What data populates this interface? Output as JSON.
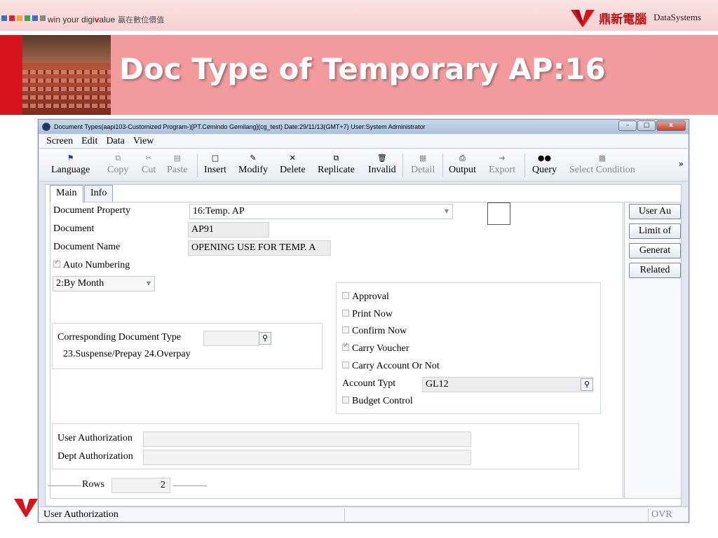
{
  "slide": {
    "tagline_prefix": "win your digi",
    "tagline_v": "v",
    "tagline_suffix": "alue",
    "tagline_zh": "贏在數位價值",
    "brand_zh": "鼎新電腦",
    "brand_en": "DataSystems",
    "title": "Doc Type of Temporary AP:16",
    "square_colors": [
      "#3a6fc4",
      "#d8262a",
      "#f2a93b",
      "#3aa64a",
      "#3a6fc4",
      "#888888"
    ]
  },
  "window": {
    "title": "Document Types(aapi103-Customized Program-)[PT.Cemindo Gemilang](cg_test)  Date:29/11/13(GMT+7)  User:System Administrator",
    "controls": {
      "minimize": "–",
      "maximize": "□",
      "close": "x"
    }
  },
  "menu": [
    "Screen",
    "Edit",
    "Data",
    "View"
  ],
  "toolbar": {
    "language": "Language",
    "copy": "Copy",
    "cut": "Cut",
    "paste": "Paste",
    "insert": "Insert",
    "modify": "Modify",
    "delete": "Delete",
    "replicate": "Replicate",
    "invalid": "Invalid",
    "detail": "Detail",
    "output": "Output",
    "export": "Export",
    "query": "Query",
    "select_condition": "Select Condition",
    "more": "»"
  },
  "tabs": {
    "main": "Main",
    "info": "Info"
  },
  "form": {
    "document_property_label": "Document Property",
    "document_property_value": "16:Temp. AP",
    "document_label": "Document",
    "document_value": "AP91",
    "document_name_label": "Document Name",
    "document_name_value": "OPENING USE FOR TEMP. A",
    "auto_numbering_label": "Auto Numbering",
    "auto_numbering_checked": true,
    "numbering_mode": "2:By Month",
    "corresponding_label": "Corresponding Document Type",
    "corresponding_value": "",
    "corresponding_hint": "23.Suspense/Prepay 24.Overpay",
    "approval_label": "Approval",
    "print_now_label": "Print Now",
    "confirm_now_label": "Confirm Now",
    "carry_voucher_label": "Carry Voucher",
    "carry_voucher_checked": true,
    "carry_account_label": "Carry Account Or Not",
    "account_type_label": "Account Typt",
    "account_type_value": "GL12",
    "budget_control_label": "Budget Control",
    "user_auth_label": "User Authorization",
    "user_auth_value": "",
    "dept_auth_label": "Dept Authorization",
    "dept_auth_value": ""
  },
  "side_buttons": [
    "User Au",
    "Limit of",
    "Generat",
    "Related"
  ],
  "rows": {
    "label": "Rows",
    "value": "2"
  },
  "status": {
    "message": "User Authorization",
    "mode": "OVR"
  }
}
